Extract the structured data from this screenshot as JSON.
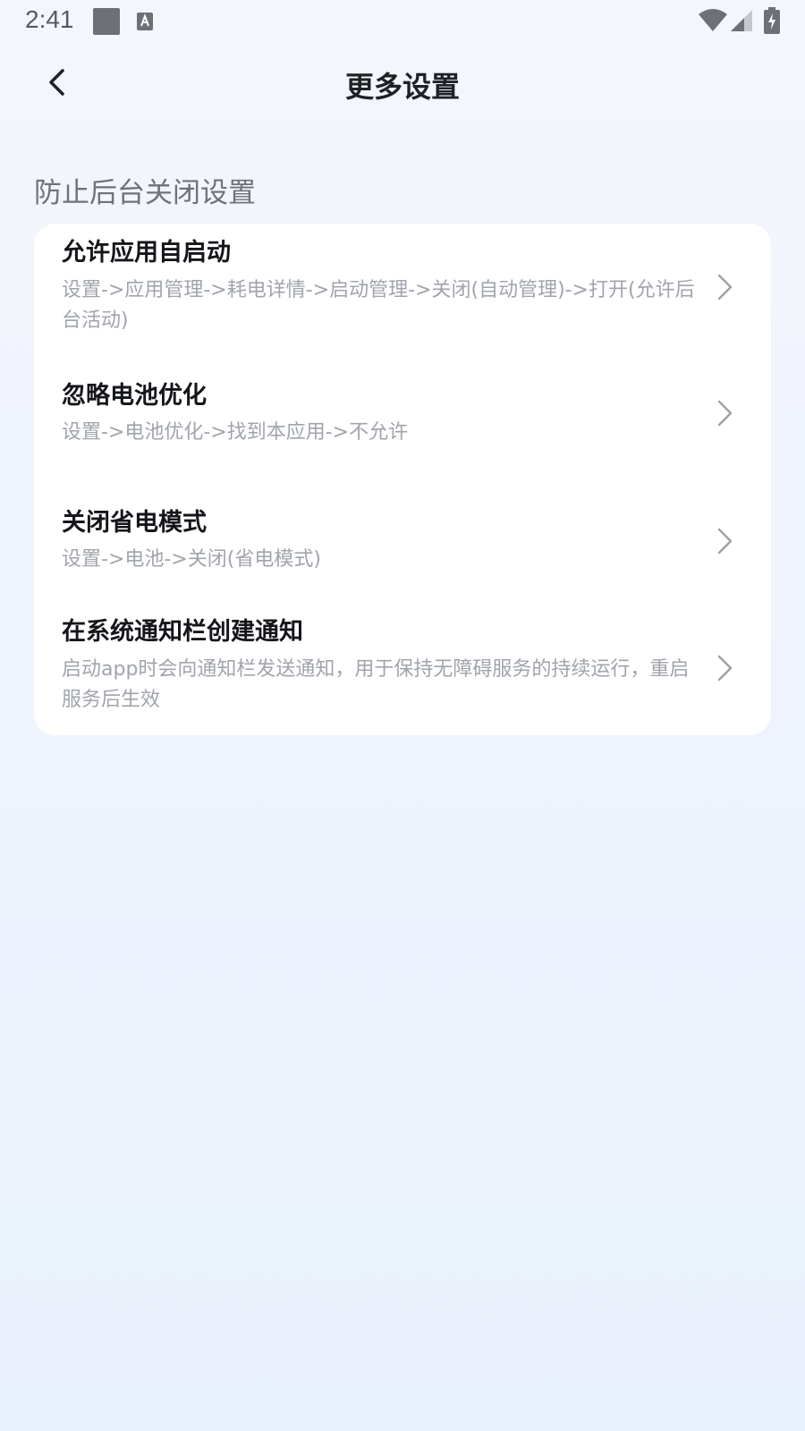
{
  "status_bar": {
    "time": "2:41"
  },
  "header": {
    "title": "更多设置"
  },
  "section": {
    "title": "防止后台关闭设置"
  },
  "items": [
    {
      "title": "允许应用自启动",
      "desc": "设置->应用管理->耗电详情->启动管理->关闭(自动管理)->打开(允许后台活动)"
    },
    {
      "title": "忽略电池优化",
      "desc": "设置->电池优化->找到本应用->不允许"
    },
    {
      "title": "关闭省电模式",
      "desc": "设置->电池->关闭(省电模式)"
    },
    {
      "title": "在系统通知栏创建通知",
      "desc": "启动app时会向通知栏发送通知，用于保持无障碍服务的持续运行，重启服务后生效"
    }
  ],
  "icons": {
    "back": "back-arrow-icon",
    "chevron": "chevron-right-icon"
  },
  "colors": {
    "card": "#ffffff",
    "title": "#14161a",
    "desc": "#a0a4ab",
    "section": "#6d727b"
  }
}
